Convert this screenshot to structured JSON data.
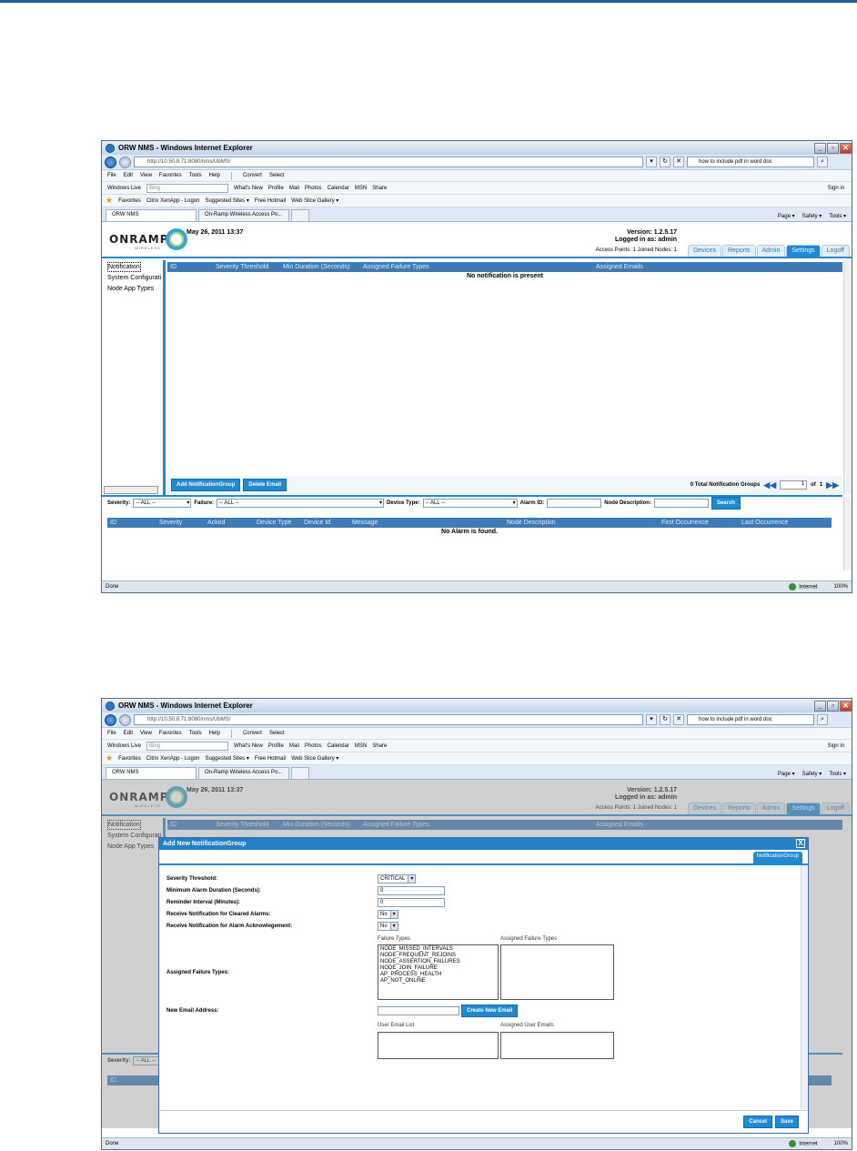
{
  "browser": {
    "title": "ORW NMS - Windows Internet Explorer",
    "url": "http://10.50.8.71:8080/nms/UbMS/",
    "search_text": "how to include pdf in word doc",
    "menu": [
      "File",
      "Edit",
      "View",
      "Favorites",
      "Tools",
      "Help"
    ],
    "convert_label": "Convert",
    "select_label": "Select",
    "live_label": "Windows Live",
    "bing_placeholder": "Bing",
    "live_links": [
      "What's New",
      "Profile",
      "Mail",
      "Photos",
      "Calendar",
      "MSN",
      "Share"
    ],
    "sign_in": "Sign in",
    "favorites_label": "Favorites",
    "favorites": [
      "Citrix XenApp - Logon",
      "Suggested Sites ▾",
      "Free Hotmail",
      "Web Slice Gallery ▾"
    ],
    "tabs": [
      "ORW NMS",
      "On-Ramp Wireless Access Po..."
    ],
    "commands": [
      "Page ▾",
      "Safety ▾",
      "Tools ▾"
    ],
    "status_left": "Done",
    "status_zone": "Internet",
    "zoom": "100%"
  },
  "app": {
    "logo": "ONRAMP",
    "logo_sub": "WIRELESS",
    "date": "May 26, 2011 13:37",
    "version": "Version: 1.2.5.17",
    "logged_in": "Logged in as: admin",
    "ap_info": "Access Points: 1 Joined Nodes: 1",
    "nav": [
      "Devices",
      "Reports",
      "Admin",
      "Settings",
      "Logoff"
    ],
    "active_nav": "Settings",
    "sidebar": [
      "Notification",
      "System Configurati",
      "Node App Types"
    ],
    "grid_columns": [
      "ID",
      "Severity Threshold",
      "Min Duration (Seconds)",
      "Assigned Failure Types",
      "Assigned Emails"
    ],
    "grid_empty": "No notification is present",
    "add_button": "Add NotificationGroup",
    "delete_button": "Delete Email",
    "total_label": "0 Total Notification Groups",
    "page_current": "1",
    "page_of": "of",
    "page_total": "1",
    "filters": {
      "severity_label": "Severity:",
      "severity_value": "-- ALL --",
      "failure_label": "Failure:",
      "failure_value": "-- ALL --",
      "device_type_label": "Device Type:",
      "device_type_value": "-- ALL --",
      "alarm_id_label": "Alarm ID:",
      "node_desc_label": "Node Description:",
      "search_button": "Search"
    },
    "alarm_columns": [
      "ID",
      "Severity",
      "Acked",
      "Device Type",
      "Device Id",
      "Message",
      "Node Description",
      "First Occurrence",
      "Last Occurrence"
    ],
    "alarm_empty": "No Alarm is found."
  },
  "dialog": {
    "title": "Add New NotificationGroup",
    "close": "X",
    "tab": "NotificationGroup",
    "severity_label": "Severity Threshold:",
    "severity_value": "CRITICAL",
    "min_duration_label": "Minimum Alarm Duration (Seconds):",
    "min_duration_value": "0",
    "reminder_label": "Reminder Interval (Minutes):",
    "reminder_value": "0",
    "cleared_label": "Receive Notification for Cleared Alarms:",
    "cleared_value": "No",
    "ack_label": "Receive Notification for Alarm Acknowlegement:",
    "ack_value": "No",
    "failure_types_header": "Failure Types",
    "assigned_failure_header": "Assigned Failure Types",
    "assigned_failure_label": "Assigned Failure Types:",
    "failure_types": [
      "NODE_MISSED_INTERVALS",
      "NODE_FREQUENT_REJOINS",
      "NODE_ASSERTION_FAILURES",
      "NODE_JOIN_FAILURE",
      "AP_PROCESS_HEALTH",
      "AP_NOT_ONLINE"
    ],
    "new_email_label": "New Email Address:",
    "create_email_button": "Create New Email",
    "user_email_header": "User Email List",
    "assigned_email_header": "Assigned User Emails",
    "cancel": "Cancel",
    "save": "Save"
  },
  "colors": {
    "accent": "#1e8ad6",
    "grid_header": "#3d7bb8"
  }
}
